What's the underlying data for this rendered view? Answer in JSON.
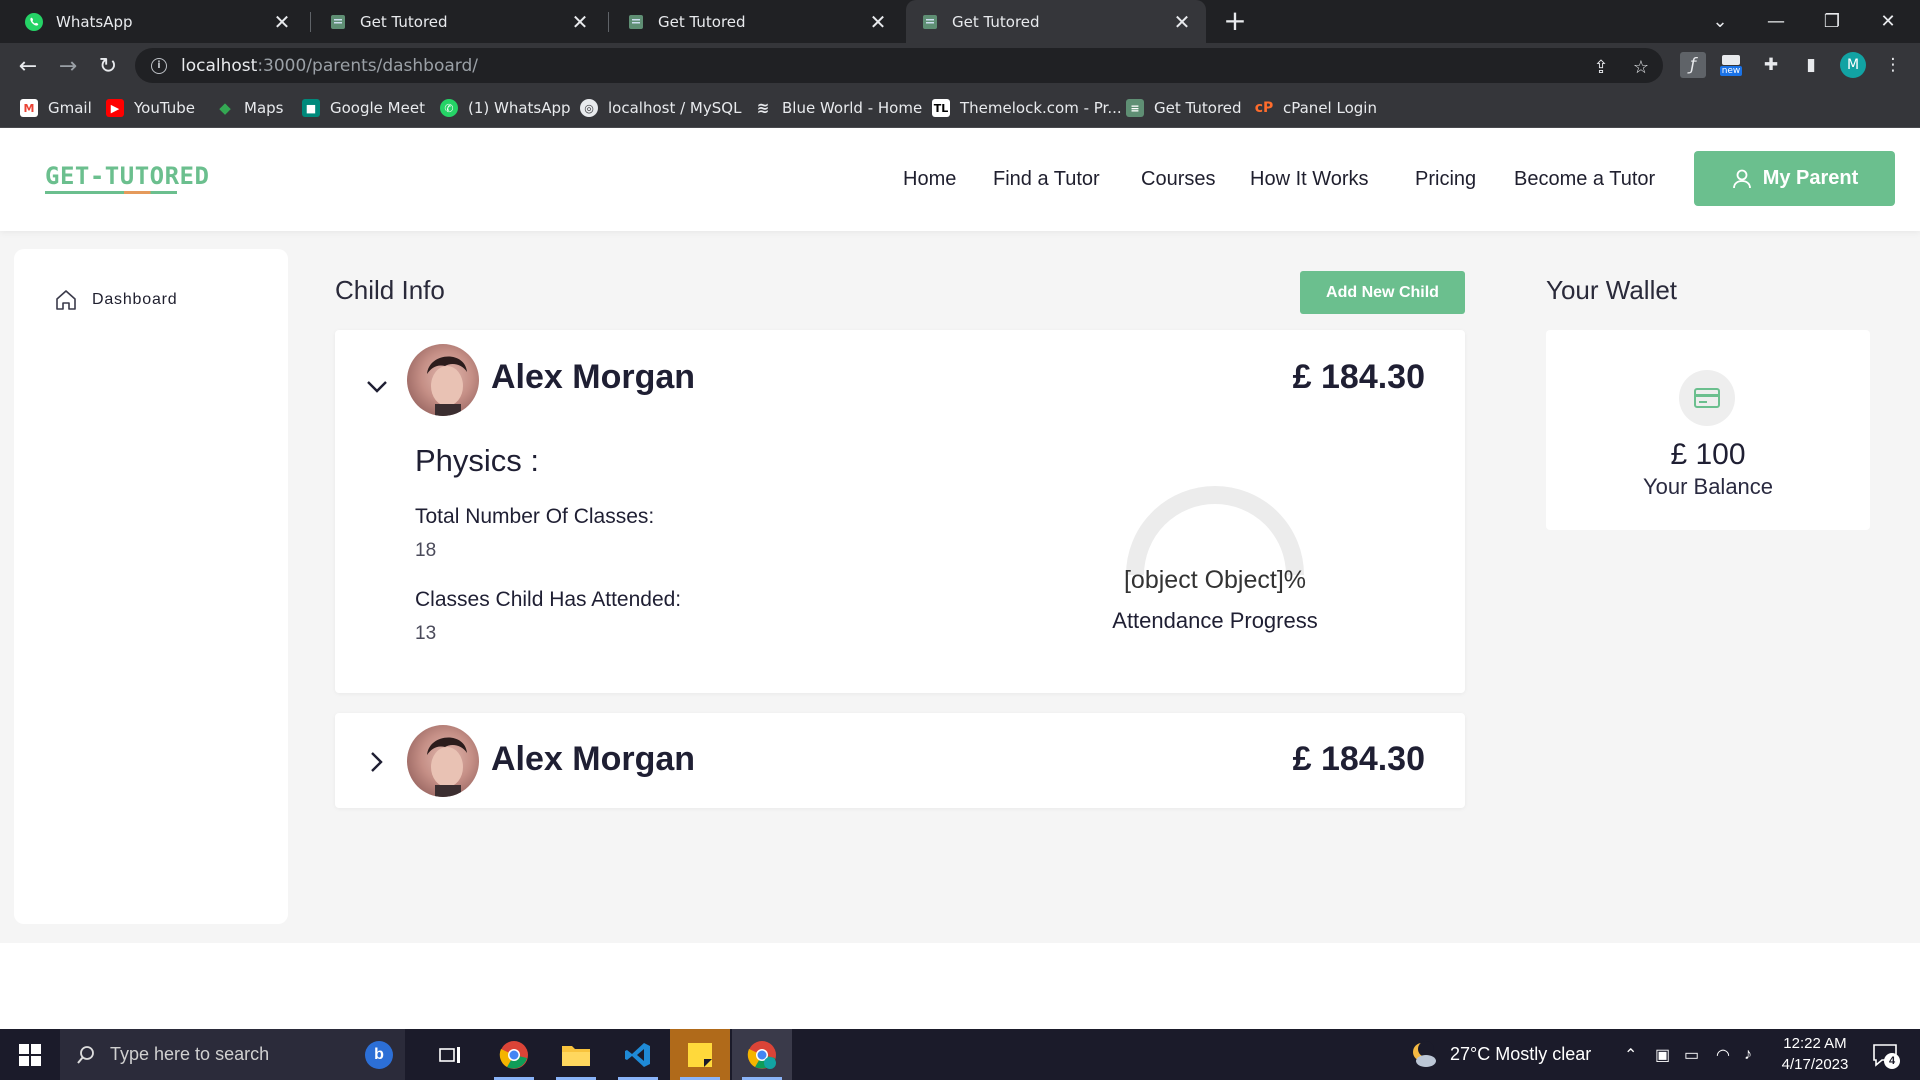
{
  "browser": {
    "tabs": [
      {
        "title": "WhatsApp",
        "icon": "whatsapp-icon"
      },
      {
        "title": "Get Tutored",
        "icon": "page-icon"
      },
      {
        "title": "Get Tutored",
        "icon": "page-icon"
      },
      {
        "title": "Get Tutored",
        "icon": "page-icon",
        "active": true
      }
    ],
    "url_host": "localhost",
    "url_path": ":3000/parents/dashboard/",
    "profile_initial": "M",
    "ext_badge": "new",
    "bookmarks": [
      {
        "label": "Gmail",
        "icon": "gmail-icon"
      },
      {
        "label": "YouTube",
        "icon": "youtube-icon"
      },
      {
        "label": "Maps",
        "icon": "maps-icon"
      },
      {
        "label": "Google Meet",
        "icon": "meet-icon"
      },
      {
        "label": "(1) WhatsApp",
        "icon": "whatsapp-icon"
      },
      {
        "label": "localhost / MySQL",
        "icon": "globe-icon"
      },
      {
        "label": "Blue World - Home",
        "icon": "stack-icon"
      },
      {
        "label": "Themelock.com - Pr...",
        "icon": "themelock-icon"
      },
      {
        "label": "Get Tutored",
        "icon": "page-icon"
      },
      {
        "label": "cPanel Login",
        "icon": "cpanel-icon"
      }
    ]
  },
  "site": {
    "logo_text": "GET-TUTORED",
    "nav": [
      "Home",
      "Find a Tutor",
      "Courses",
      "How It Works",
      "Pricing",
      "Become a Tutor"
    ],
    "account_button": "My Parent",
    "accent_color": "#6bbf8e"
  },
  "sidebar": {
    "items": [
      {
        "label": "Dashboard",
        "icon": "home-icon"
      }
    ]
  },
  "child_info": {
    "title": "Child Info",
    "add_button": "Add New Child",
    "children": [
      {
        "name": "Alex Morgan",
        "amount": "£ 184.30",
        "expanded": true,
        "subject": "Physics :",
        "total_label": "Total Number Of Classes:",
        "total_value": "18",
        "attended_label": "Classes Child Has Attended:",
        "attended_value": "13",
        "gauge_text": "[object Object]%",
        "gauge_caption": "Attendance Progress"
      },
      {
        "name": "Alex Morgan",
        "amount": "£ 184.30",
        "expanded": false
      }
    ]
  },
  "wallet": {
    "title": "Your Wallet",
    "amount": "£ 100",
    "label": "Your Balance",
    "icon": "credit-card-icon"
  },
  "taskbar": {
    "search_placeholder": "Type here to search",
    "weather": "27°C  Mostly clear",
    "time": "12:22 AM",
    "date": "4/17/2023",
    "notification_count": "4"
  }
}
